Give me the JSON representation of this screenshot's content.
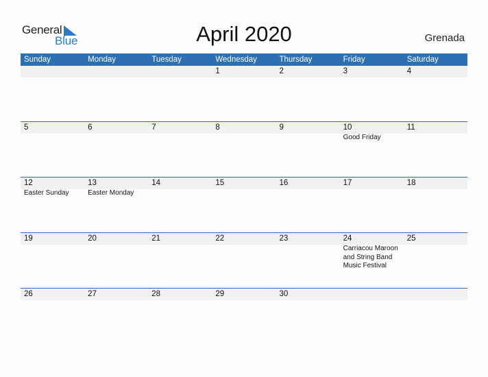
{
  "logo": {
    "line1": "General",
    "line2": "Blue"
  },
  "title": "April 2020",
  "country": "Grenada",
  "colors": {
    "header_bg": "#2d6fb3",
    "logo_blue": "#2a7cc7",
    "date_band": "#f1f1f1"
  },
  "weekdays": [
    "Sunday",
    "Monday",
    "Tuesday",
    "Wednesday",
    "Thursday",
    "Friday",
    "Saturday"
  ],
  "weeks": [
    {
      "days": [
        {
          "d": "",
          "e": ""
        },
        {
          "d": "",
          "e": ""
        },
        {
          "d": "",
          "e": ""
        },
        {
          "d": "1",
          "e": ""
        },
        {
          "d": "2",
          "e": ""
        },
        {
          "d": "3",
          "e": ""
        },
        {
          "d": "4",
          "e": ""
        }
      ]
    },
    {
      "days": [
        {
          "d": "5",
          "e": ""
        },
        {
          "d": "6",
          "e": ""
        },
        {
          "d": "7",
          "e": ""
        },
        {
          "d": "8",
          "e": ""
        },
        {
          "d": "9",
          "e": ""
        },
        {
          "d": "10",
          "e": "Good Friday"
        },
        {
          "d": "11",
          "e": ""
        }
      ]
    },
    {
      "days": [
        {
          "d": "12",
          "e": "Easter Sunday"
        },
        {
          "d": "13",
          "e": "Easter Monday"
        },
        {
          "d": "14",
          "e": ""
        },
        {
          "d": "15",
          "e": ""
        },
        {
          "d": "16",
          "e": ""
        },
        {
          "d": "17",
          "e": ""
        },
        {
          "d": "18",
          "e": ""
        }
      ]
    },
    {
      "days": [
        {
          "d": "19",
          "e": ""
        },
        {
          "d": "20",
          "e": ""
        },
        {
          "d": "21",
          "e": ""
        },
        {
          "d": "22",
          "e": ""
        },
        {
          "d": "23",
          "e": ""
        },
        {
          "d": "24",
          "e": "Carriacou Maroon and String Band Music Festival"
        },
        {
          "d": "25",
          "e": ""
        }
      ]
    },
    {
      "days": [
        {
          "d": "26",
          "e": ""
        },
        {
          "d": "27",
          "e": ""
        },
        {
          "d": "28",
          "e": ""
        },
        {
          "d": "29",
          "e": ""
        },
        {
          "d": "30",
          "e": ""
        },
        {
          "d": "",
          "e": ""
        },
        {
          "d": "",
          "e": ""
        }
      ]
    }
  ]
}
